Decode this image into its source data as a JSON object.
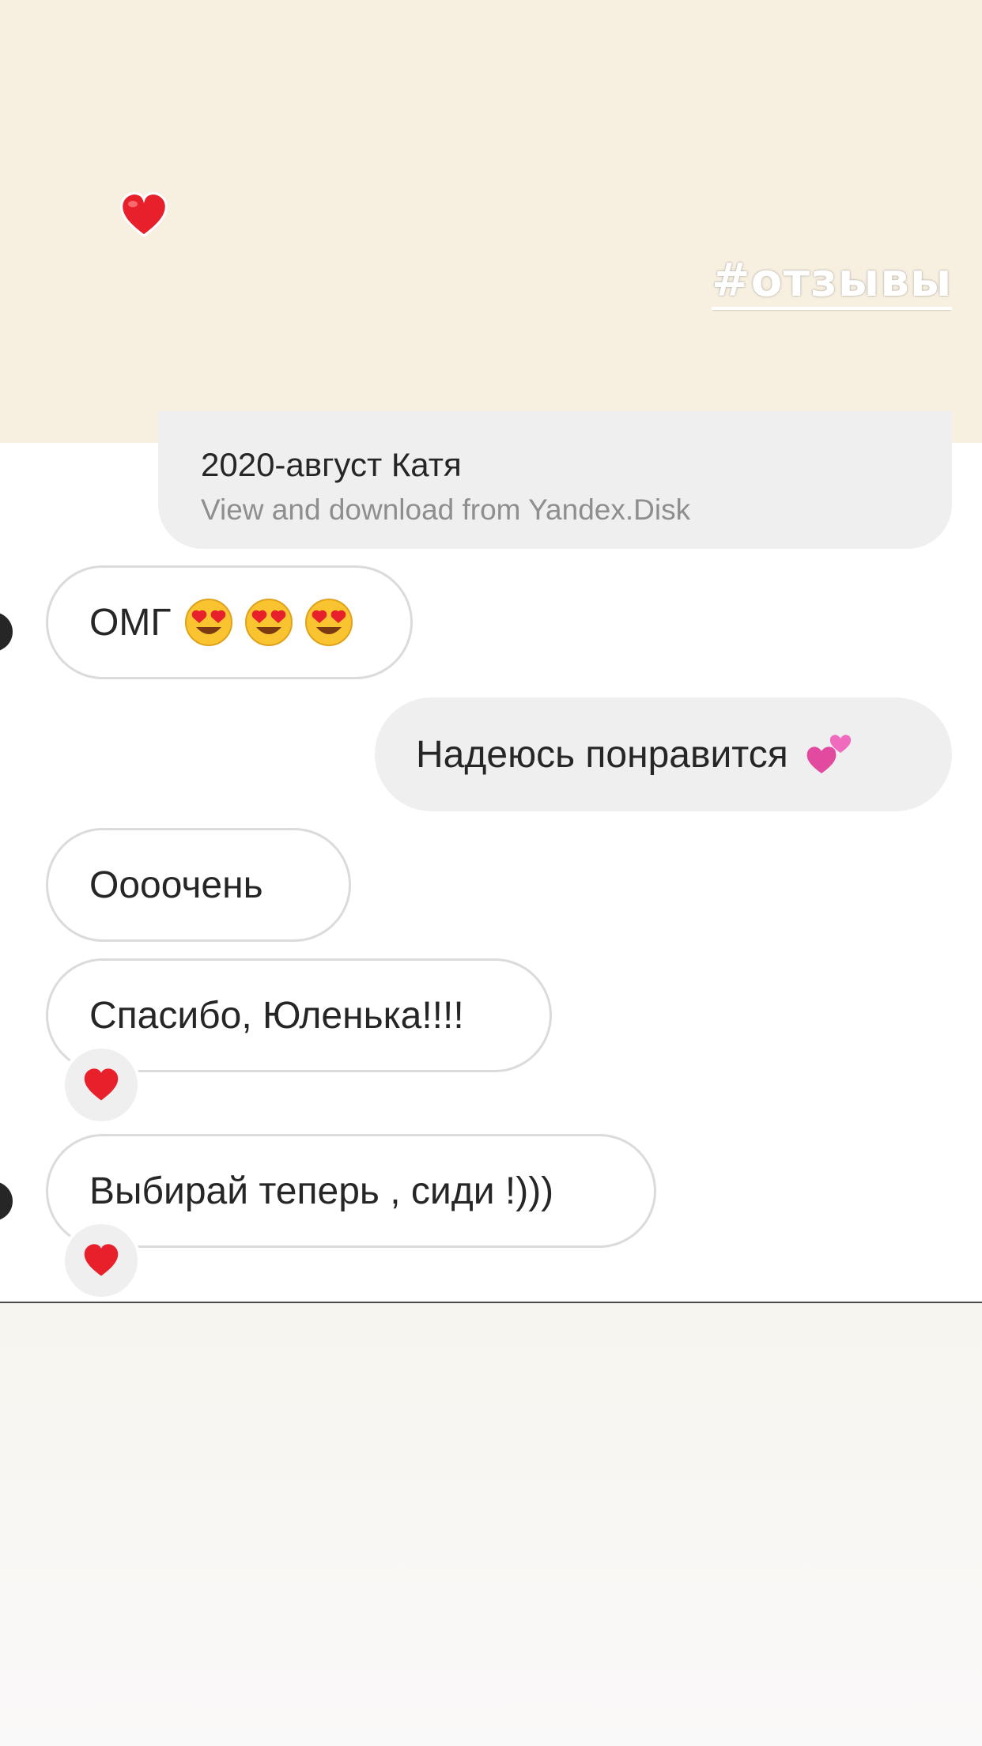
{
  "story": {
    "hashtag": "#отзывы"
  },
  "link_preview": {
    "title": "2020-август Катя",
    "subtitle": "View and download from Yandex.Disk"
  },
  "messages": [
    {
      "text": "ОМГ",
      "emojis": [
        "heart-eyes-emoji",
        "heart-eyes-emoji",
        "heart-eyes-emoji"
      ]
    },
    {
      "text": "Надеюсь понравится",
      "emojis": [
        "two-hearts-emoji"
      ]
    },
    {
      "text": "Оооочень"
    },
    {
      "text": "Спасибо, Юленька!!!!",
      "reaction": "red-heart"
    },
    {
      "text": "Выбирай теперь , сиди !)))",
      "reaction": "red-heart"
    }
  ],
  "colors": {
    "story_bg": "#f7f0e1",
    "bubble_out": "#efefef",
    "bubble_in_border": "#dbdbdb",
    "heart": "#e8202c"
  }
}
